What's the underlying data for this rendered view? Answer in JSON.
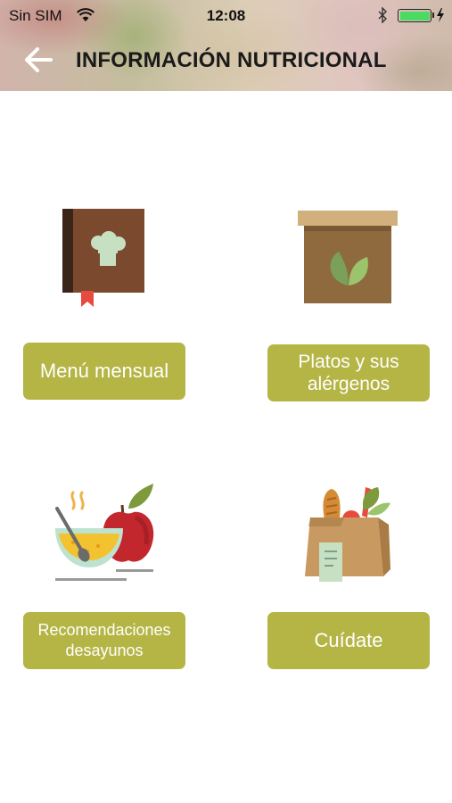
{
  "status_bar": {
    "carrier": "Sin SIM",
    "time": "12:08",
    "icons": [
      "wifi-icon",
      "bluetooth-icon",
      "battery-icon",
      "charging-icon"
    ],
    "battery_level": 1.0
  },
  "header": {
    "title": "INFORMACIÓN NUTRICIONAL",
    "back_icon": "arrow-left-icon"
  },
  "tiles": [
    {
      "icon": "recipe-book-chef-hat-icon",
      "label": "Menú mensual"
    },
    {
      "icon": "box-with-leaves-icon",
      "label": "Platos y sus alérgenos"
    },
    {
      "icon": "soup-bowl-and-apple-icon",
      "label": "Recomendaciones desayunos"
    },
    {
      "icon": "grocery-bag-icon",
      "label": "Cuídate"
    }
  ],
  "colors": {
    "button": "#b5b545",
    "button_text": "#ffffff",
    "title_text": "#1a1a1a",
    "battery": "#4cd964"
  }
}
